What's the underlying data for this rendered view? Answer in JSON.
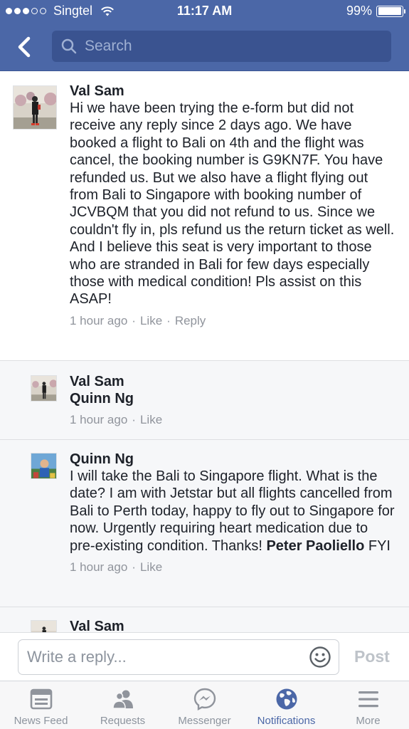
{
  "status_bar": {
    "carrier": "Singtel",
    "time": "11:17 AM",
    "battery": "99%",
    "battery_level": 0.99,
    "signal_bars": 3,
    "signal_total": 5
  },
  "search": {
    "placeholder": "Search"
  },
  "comments": [
    {
      "name": "Val Sam",
      "text": "Hi we have been trying the e-form but did not receive any reply since 2 days ago. We have booked a flight to Bali on 4th and the flight was cancel, the booking number is G9KN7F. You have refunded us. But we also have a flight flying out from Bali to Singapore with booking number of JCVBQM that you did not refund to us. Since we couldn't fly in, pls refund us the return ticket as well. And I believe this seat is very important to those who are stranded in Bali for few days especially those with medical condition! Pls assist on this ASAP!",
      "time": "1 hour ago",
      "like": "Like",
      "reply": "Reply"
    },
    {
      "name": "Val Sam",
      "mention": "Quinn Ng",
      "time": "1 hour ago",
      "like": "Like"
    },
    {
      "name": "Quinn Ng",
      "text": "I will take the Bali to Singapore flight. What is the date? I am with Jetstar but all flights cancelled from Bali to Perth today, happy to fly out to Singapore for now. Urgently requiring heart medication due to pre-existing condition. Thanks!",
      "mention": "Peter Paoliello",
      "suffix": "FYI",
      "time": "1 hour ago",
      "like": "Like"
    },
    {
      "name": "Val Sam"
    }
  ],
  "composer": {
    "placeholder": "Write a reply...",
    "post_label": "Post"
  },
  "tabs": [
    {
      "label": "News Feed",
      "icon": "news-feed-icon"
    },
    {
      "label": "Requests",
      "icon": "friend-requests-icon"
    },
    {
      "label": "Messenger",
      "icon": "messenger-icon"
    },
    {
      "label": "Notifications",
      "icon": "globe-icon",
      "active": true
    },
    {
      "label": "More",
      "icon": "menu-icon"
    }
  ],
  "colors": {
    "header": "#4b67a7",
    "search_bg": "#3a5390",
    "accent": "#4b67a7",
    "muted": "#90949c"
  }
}
